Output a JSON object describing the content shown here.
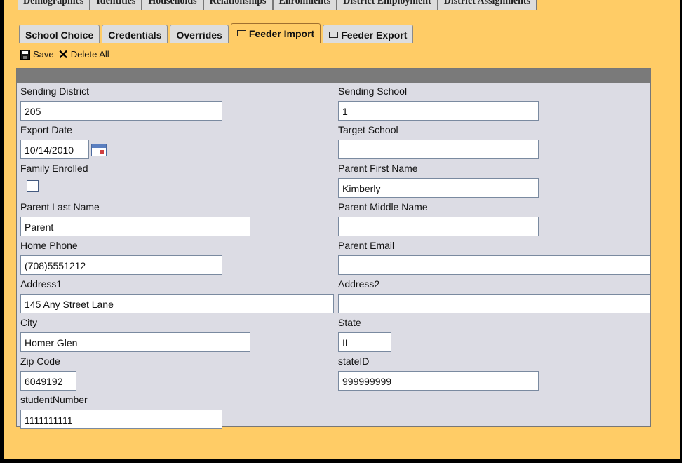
{
  "top_tabs": [
    "Demographics",
    "Identities",
    "Households",
    "Relationships",
    "Enrollments",
    "District Employment",
    "District Assignments"
  ],
  "tabs": [
    {
      "label": "School Choice",
      "icon": null
    },
    {
      "label": "Credentials",
      "icon": null
    },
    {
      "label": "Overrides",
      "icon": null
    },
    {
      "label": "Feeder Import",
      "icon": "folder-icon",
      "active": true
    },
    {
      "label": "Feeder Export",
      "icon": "folder-icon"
    }
  ],
  "toolbar": {
    "save_label": "Save",
    "delete_all_label": "Delete All"
  },
  "form": {
    "sending_district": {
      "label": "Sending District",
      "value": "205"
    },
    "sending_school": {
      "label": "Sending School",
      "value": "1"
    },
    "export_date": {
      "label": "Export Date",
      "value": "10/14/2010"
    },
    "target_school": {
      "label": "Target School",
      "value": ""
    },
    "family_enrolled": {
      "label": "Family Enrolled",
      "checked": false
    },
    "parent_first_name": {
      "label": "Parent First Name",
      "value": "Kimberly"
    },
    "parent_last_name": {
      "label": "Parent Last Name",
      "value": "Parent"
    },
    "parent_middle_name": {
      "label": "Parent Middle Name",
      "value": ""
    },
    "home_phone": {
      "label": "Home Phone",
      "value": "(708)5551212"
    },
    "parent_email": {
      "label": "Parent Email",
      "value": ""
    },
    "address1": {
      "label": "Address1",
      "value": "145 Any Street Lane"
    },
    "address2": {
      "label": "Address2",
      "value": ""
    },
    "city": {
      "label": "City",
      "value": "Homer Glen"
    },
    "state": {
      "label": "State",
      "value": "IL"
    },
    "zip_code": {
      "label": "Zip Code",
      "value": "6049192"
    },
    "state_id": {
      "label": "stateID",
      "value": "999999999"
    },
    "student_number": {
      "label": "studentNumber",
      "value": "1111111111"
    }
  }
}
